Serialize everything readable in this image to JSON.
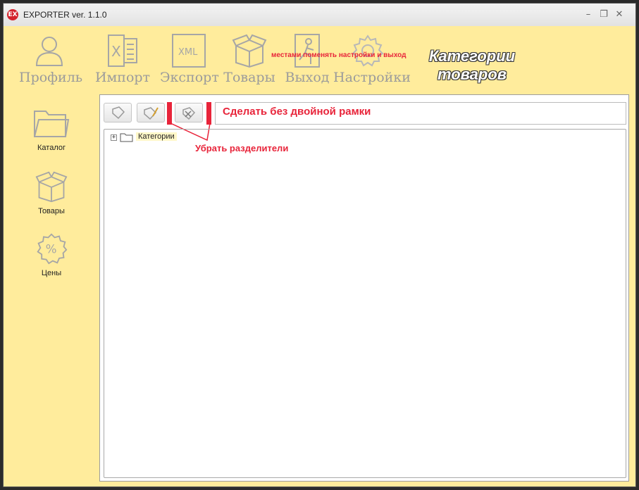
{
  "window": {
    "title": "EXPORTER ver. 1.1.0",
    "app_icon_text": "EX"
  },
  "toolbar": {
    "items": [
      {
        "label": "Профиль",
        "icon": "person-icon"
      },
      {
        "label": "Импорт",
        "icon": "excel-icon"
      },
      {
        "label": "Экспорт",
        "icon": "xml-icon",
        "icon_text": "XML"
      },
      {
        "label": "Товары",
        "icon": "box-icon"
      },
      {
        "label": "Выход",
        "icon": "exit-door-icon"
      },
      {
        "label": "Настройки",
        "icon": "gear-icon"
      }
    ]
  },
  "annotations": {
    "swap_note": "местами поменять настройки и выход",
    "categories_heading": "Категории товаров",
    "frame_note": "Сделать без двойной рамки",
    "separators_note": "Убрать разделители"
  },
  "sidebar": {
    "items": [
      {
        "label": "Каталог",
        "icon": "folder-icon"
      },
      {
        "label": "Товары",
        "icon": "box-icon"
      },
      {
        "label": "Цены",
        "icon": "percent-badge-icon"
      }
    ]
  },
  "tree": {
    "root_label": "Категории",
    "expander": "+"
  },
  "colors": {
    "panel_bg": "#ffec9c",
    "annotation_red": "#e8243a"
  }
}
